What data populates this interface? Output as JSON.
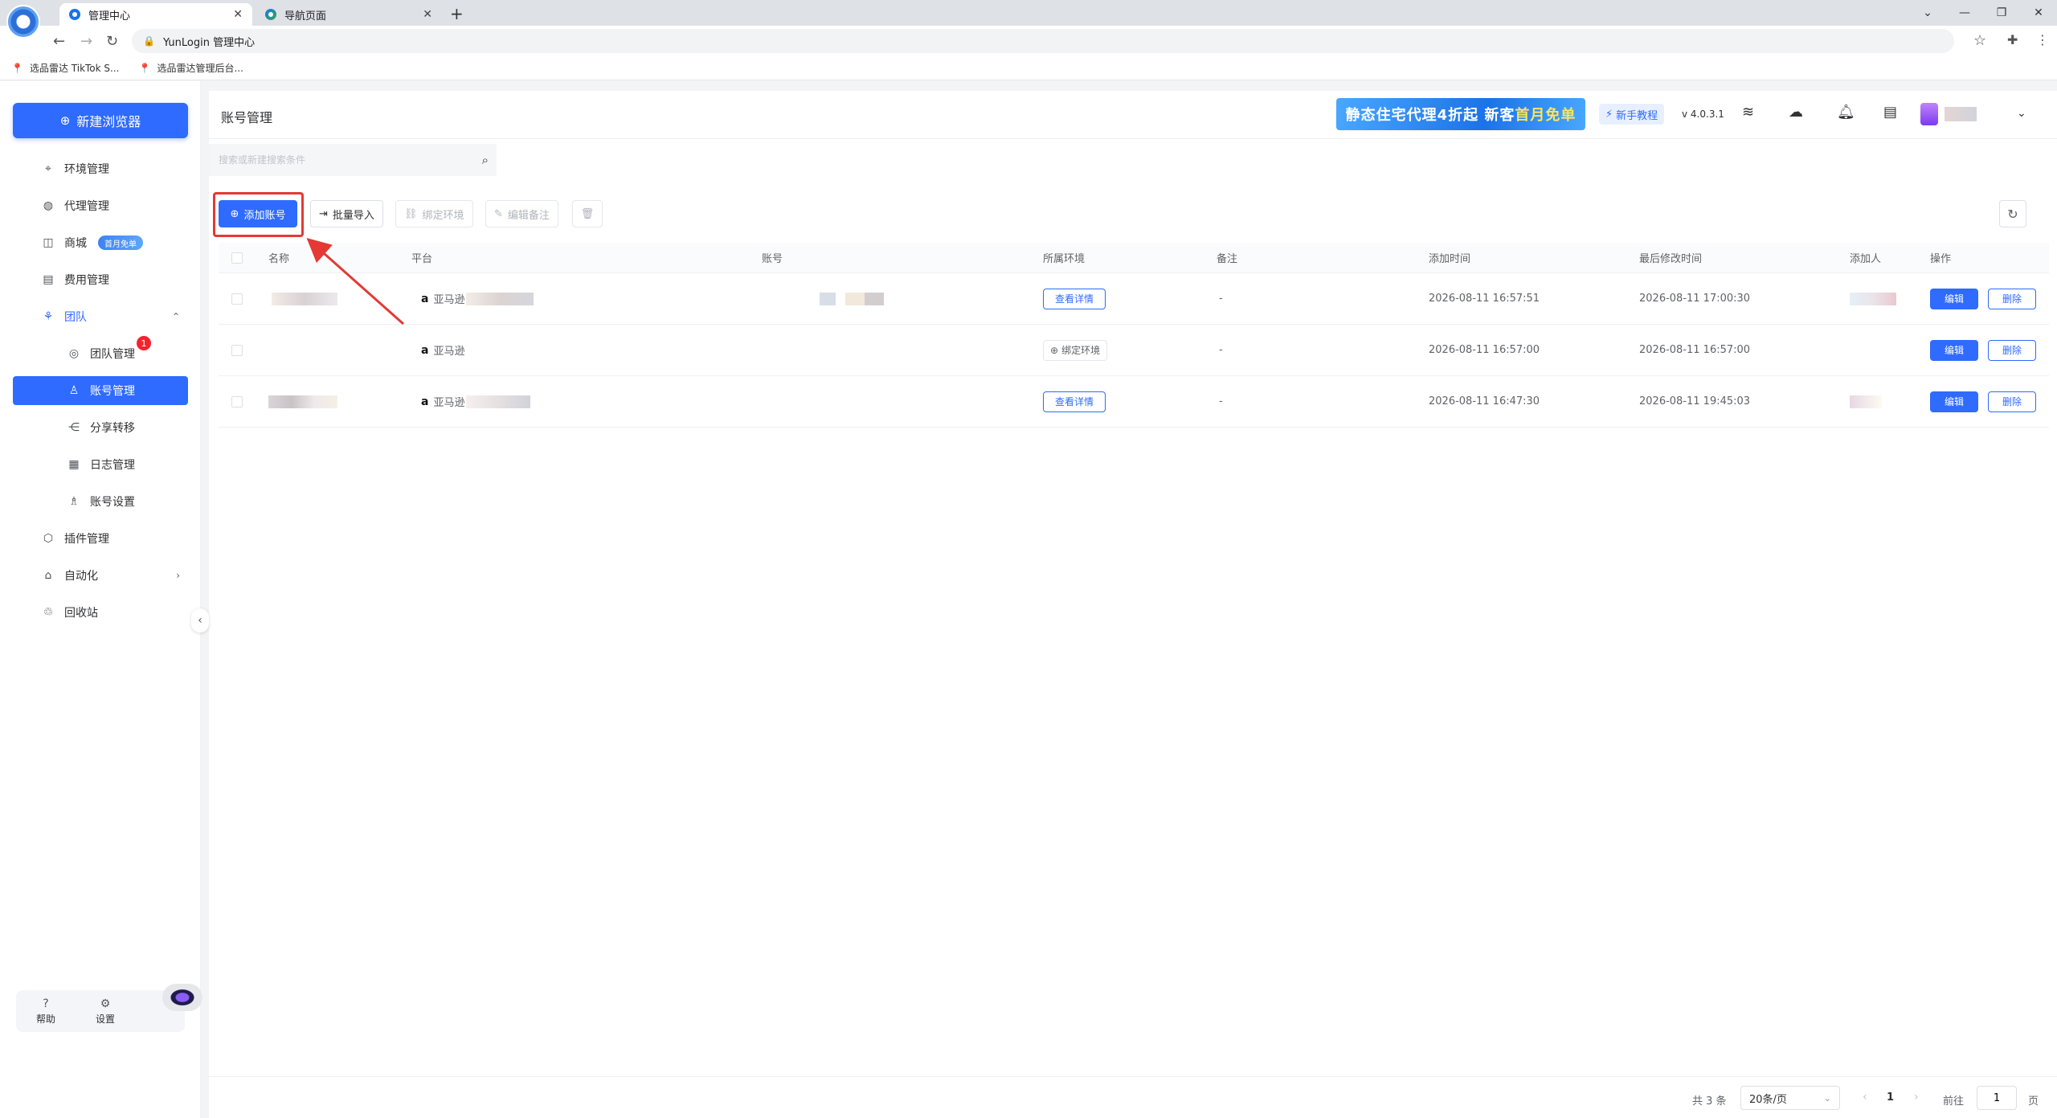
{
  "browser": {
    "tabs": [
      {
        "label": "管理中心",
        "active": true
      },
      {
        "label": "导航页面",
        "active": false
      }
    ],
    "url": "YunLogin 管理中心",
    "bookmarks": [
      "选品雷达 TikTok S...",
      "选品雷达管理后台..."
    ]
  },
  "sidebar": {
    "new_browser": "新建浏览器",
    "items": [
      {
        "label": "环境管理",
        "icon": "environment-icon"
      },
      {
        "label": "代理管理",
        "icon": "globe-icon"
      },
      {
        "label": "商城",
        "icon": "shop-icon",
        "badge": "首月免单"
      },
      {
        "label": "费用管理",
        "icon": "billing-icon"
      },
      {
        "label": "团队",
        "icon": "team-icon"
      },
      {
        "label": "团队管理",
        "icon": "team-manage-icon",
        "badge_count": "1"
      },
      {
        "label": "账号管理",
        "icon": "user-icon"
      },
      {
        "label": "分享转移",
        "icon": "share-icon"
      },
      {
        "label": "日志管理",
        "icon": "log-icon"
      },
      {
        "label": "账号设置",
        "icon": "user-settings-icon"
      },
      {
        "label": "插件管理",
        "icon": "plugin-icon"
      },
      {
        "label": "自动化",
        "icon": "automation-icon"
      },
      {
        "label": "回收站",
        "icon": "recycle-icon"
      }
    ],
    "footer": {
      "help": "帮助",
      "settings": "设置"
    }
  },
  "header": {
    "title": "账号管理",
    "promo": {
      "part1": "静态住宅代理4折起 新客",
      "part2": "首月免单"
    },
    "tutorial": "新手教程",
    "version": "v 4.0.3.1"
  },
  "search": {
    "placeholder": "搜索或新建搜索条件"
  },
  "toolbar": {
    "add": "添加账号",
    "import": "批量导入",
    "bind": "绑定环境",
    "note": "编辑备注"
  },
  "table": {
    "columns": [
      "名称",
      "平台",
      "账号",
      "所属环境",
      "备注",
      "添加时间",
      "最后修改时间",
      "添加人",
      "操作"
    ],
    "rows": [
      {
        "platform": "亚马逊",
        "env": "查看详情",
        "note": "-",
        "added": "2026-08-11 16:57:51",
        "modified": "2026-08-11 17:00:30",
        "edit": "编辑",
        "delete": "删除"
      },
      {
        "platform": "亚马逊",
        "env": "绑定环境",
        "note": "-",
        "added": "2026-08-11 16:57:00",
        "modified": "2026-08-11 16:57:00",
        "edit": "编辑",
        "delete": "删除"
      },
      {
        "platform": "亚马逊",
        "env": "查看详情",
        "note": "-",
        "added": "2026-08-11 16:47:30",
        "modified": "2026-08-11 19:45:03",
        "edit": "编辑",
        "delete": "删除"
      }
    ]
  },
  "pagination": {
    "total": "共 3 条",
    "page_size": "20条/页",
    "current": "1",
    "goto": "前往",
    "goto_value": "1",
    "unit": "页"
  },
  "colors": {
    "primary": "#2f6bff",
    "highlight": "#e53935"
  }
}
